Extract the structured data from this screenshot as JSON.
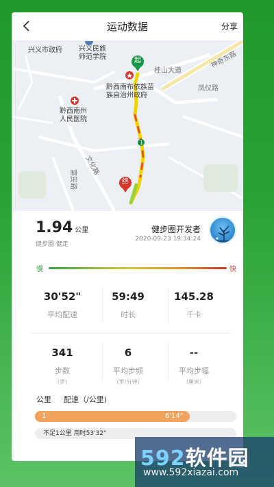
{
  "header": {
    "title": "运动数据",
    "share_label": "分享"
  },
  "map": {
    "labels": {
      "city_gov": "兴义市政府",
      "college": "兴义民族\n师范学院",
      "prefecture_gov": "黔西南布依族苗\n族自治州政府",
      "hospital": "黔西南州\n人民医院",
      "road_shenqi": "神奇东路",
      "road_guishan": "桂山大道",
      "road_fengyi": "凤仪路",
      "road_wenhua": "文化路",
      "road_fumin": "富民路"
    },
    "markers": {
      "start": "起",
      "end": "终",
      "km1": "1"
    }
  },
  "summary": {
    "distance": "1.94",
    "distance_unit": "公里",
    "activity": "健步圈·健走",
    "user_name": "健步圈开发者",
    "timestamp": "2020-09-23 19:34:24"
  },
  "speed_legend": {
    "slow": "慢",
    "fast": "快"
  },
  "stats": [
    {
      "value": "30'52\"",
      "label": "平均配速",
      "unit": ""
    },
    {
      "value": "59:49",
      "label": "时长",
      "unit": ""
    },
    {
      "value": "145.28",
      "label": "千卡",
      "unit": ""
    },
    {
      "value": "341",
      "label": "步数",
      "unit": "(步)"
    },
    {
      "value": "6",
      "label": "平均步频",
      "unit": "(步/分钟)"
    },
    {
      "value": "--",
      "label": "平均步幅",
      "unit": "(厘米)"
    }
  ],
  "pace": {
    "col_km": "公里",
    "col_pace": "配速（/公里)",
    "rows": [
      {
        "km": "1",
        "pace": "6'14\"",
        "fill_fraction": 0.77
      }
    ],
    "note": "不足1公里 用时53'32\""
  },
  "watermark": {
    "brand_num": "592",
    "brand_text": "软件园",
    "url": "www.592xiazai.com"
  },
  "colors": {
    "bg_green": "#2aa336",
    "pace_fill": "#f0a35c",
    "slow": "#3aa64a",
    "fast": "#c43a2a"
  }
}
